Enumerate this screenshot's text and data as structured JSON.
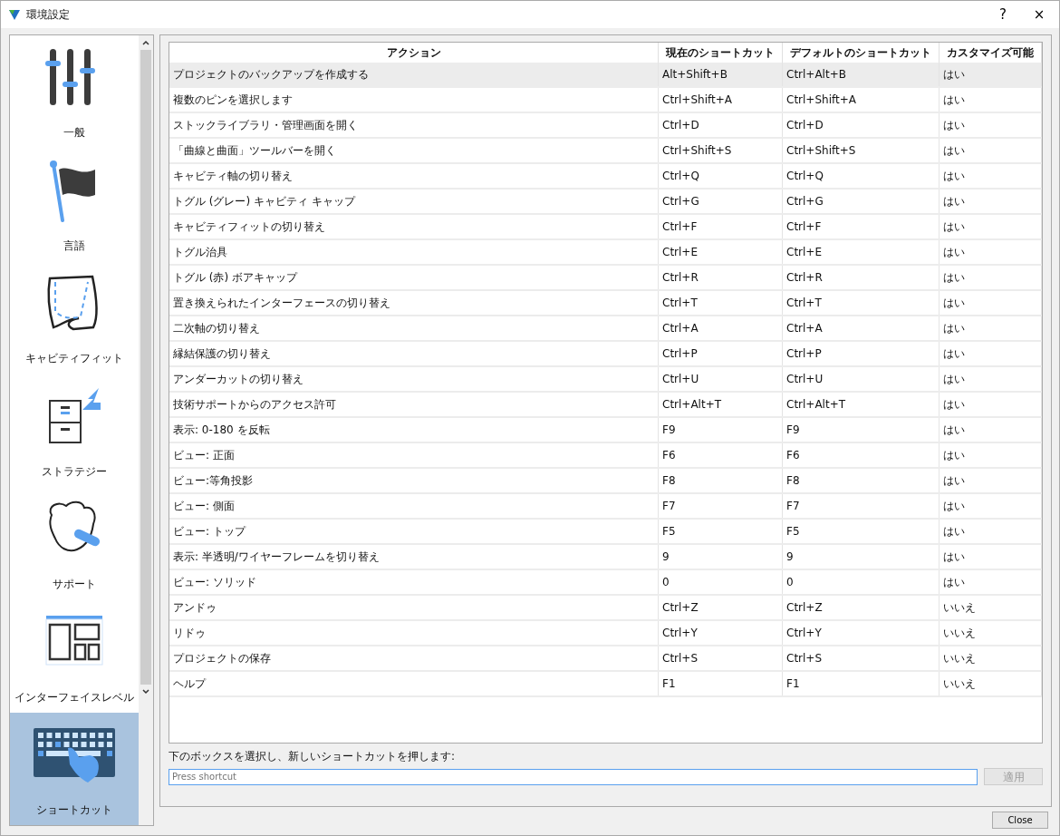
{
  "window": {
    "title": "環境設定",
    "help": "?",
    "close": "×"
  },
  "sidebar": {
    "items": [
      {
        "label": "一般",
        "selected": false
      },
      {
        "label": "言語",
        "selected": false
      },
      {
        "label": "キャビティフィット",
        "selected": false
      },
      {
        "label": "ストラテジー",
        "selected": false
      },
      {
        "label": "サポート",
        "selected": false
      },
      {
        "label": "インターフェイスレベル",
        "selected": false
      },
      {
        "label": "ショートカット",
        "selected": true
      }
    ]
  },
  "table": {
    "columns": [
      "アクション",
      "現在のショートカット",
      "デフォルトのショートカット",
      "カスタマイズ可能"
    ],
    "rows": [
      {
        "cells": [
          "プロジェクトのバックアップを作成する",
          "Alt+Shift+B",
          "Ctrl+Alt+B",
          "はい"
        ],
        "selected": true
      },
      {
        "cells": [
          "複数のピンを選択します",
          "Ctrl+Shift+A",
          "Ctrl+Shift+A",
          "はい"
        ],
        "selected": false
      },
      {
        "cells": [
          "ストックライブラリ・管理画面を開く",
          "Ctrl+D",
          "Ctrl+D",
          "はい"
        ],
        "selected": false
      },
      {
        "cells": [
          "「曲線と曲面」ツールバーを開く",
          "Ctrl+Shift+S",
          "Ctrl+Shift+S",
          "はい"
        ],
        "selected": false
      },
      {
        "cells": [
          "キャビティ軸の切り替え",
          "Ctrl+Q",
          "Ctrl+Q",
          "はい"
        ],
        "selected": false
      },
      {
        "cells": [
          "トグル (グレー) キャビティ キャップ",
          "Ctrl+G",
          "Ctrl+G",
          "はい"
        ],
        "selected": false
      },
      {
        "cells": [
          "キャビティフィットの切り替え",
          "Ctrl+F",
          "Ctrl+F",
          "はい"
        ],
        "selected": false
      },
      {
        "cells": [
          "トグル治具",
          "Ctrl+E",
          "Ctrl+E",
          "はい"
        ],
        "selected": false
      },
      {
        "cells": [
          "トグル (赤) ボアキャップ",
          "Ctrl+R",
          "Ctrl+R",
          "はい"
        ],
        "selected": false
      },
      {
        "cells": [
          "置き換えられたインターフェースの切り替え",
          "Ctrl+T",
          "Ctrl+T",
          "はい"
        ],
        "selected": false
      },
      {
        "cells": [
          "二次軸の切り替え",
          "Ctrl+A",
          "Ctrl+A",
          "はい"
        ],
        "selected": false
      },
      {
        "cells": [
          "縁結保護の切り替え",
          "Ctrl+P",
          "Ctrl+P",
          "はい"
        ],
        "selected": false
      },
      {
        "cells": [
          "アンダーカットの切り替え",
          "Ctrl+U",
          "Ctrl+U",
          "はい"
        ],
        "selected": false
      },
      {
        "cells": [
          "技術サポートからのアクセス許可",
          "Ctrl+Alt+T",
          "Ctrl+Alt+T",
          "はい"
        ],
        "selected": false
      },
      {
        "cells": [
          "表示: 0-180 を反転",
          "F9",
          "F9",
          "はい"
        ],
        "selected": false
      },
      {
        "cells": [
          "ビュー: 正面",
          "F6",
          "F6",
          "はい"
        ],
        "selected": false
      },
      {
        "cells": [
          "ビュー:等角投影",
          "F8",
          "F8",
          "はい"
        ],
        "selected": false
      },
      {
        "cells": [
          "ビュー: 側面",
          "F7",
          "F7",
          "はい"
        ],
        "selected": false
      },
      {
        "cells": [
          "ビュー: トップ",
          "F5",
          "F5",
          "はい"
        ],
        "selected": false
      },
      {
        "cells": [
          "表示: 半透明/ワイヤーフレームを切り替え",
          "9",
          "9",
          "はい"
        ],
        "selected": false
      },
      {
        "cells": [
          "ビュー: ソリッド",
          "0",
          "0",
          "はい"
        ],
        "selected": false
      },
      {
        "cells": [
          "アンドゥ",
          "Ctrl+Z",
          "Ctrl+Z",
          "いいえ"
        ],
        "selected": false
      },
      {
        "cells": [
          "リドゥ",
          "Ctrl+Y",
          "Ctrl+Y",
          "いいえ"
        ],
        "selected": false
      },
      {
        "cells": [
          "プロジェクトの保存",
          "Ctrl+S",
          "Ctrl+S",
          "いいえ"
        ],
        "selected": false
      },
      {
        "cells": [
          "ヘルプ",
          "F1",
          "F1",
          "いいえ"
        ],
        "selected": false
      }
    ]
  },
  "shortcut_entry": {
    "label": "下のボックスを選択し、新しいショートカットを押します:",
    "placeholder": "Press shortcut",
    "apply": {
      "label": "適用",
      "disabled": true
    }
  },
  "footer": {
    "close": "Close"
  }
}
